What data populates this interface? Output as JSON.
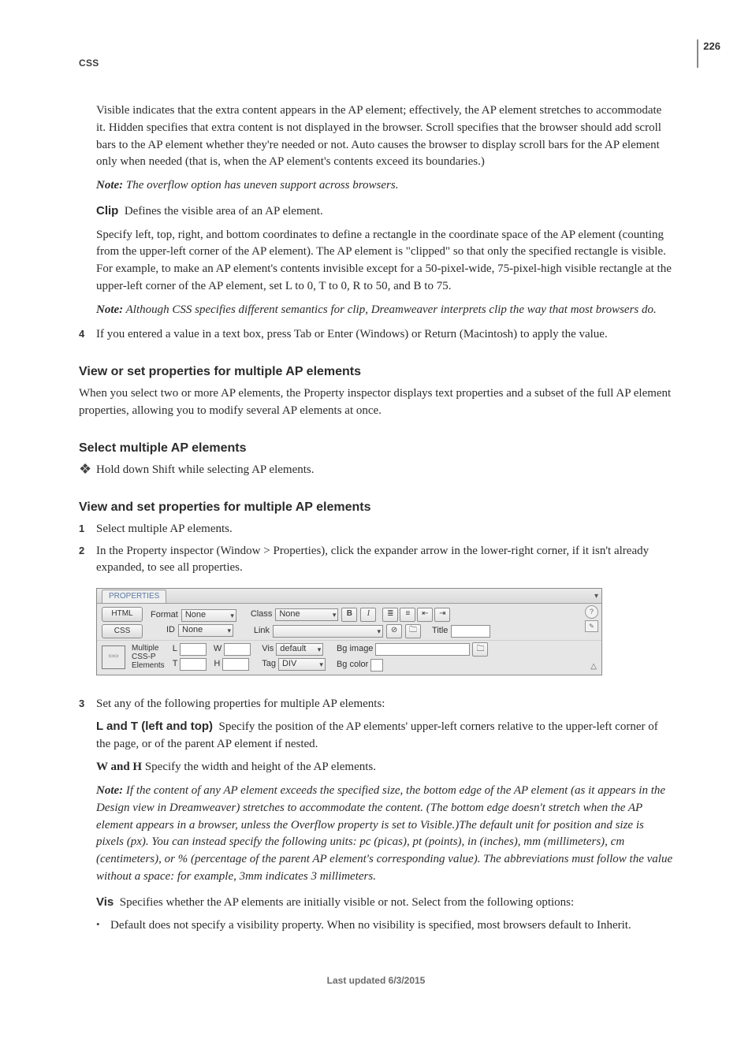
{
  "runhead": {
    "section": "CSS",
    "page_number": "226"
  },
  "intro": {
    "p1": "Visible indicates that the extra content appears in the AP element; effectively, the AP element stretches to accommodate it. Hidden specifies that extra content is not displayed in the browser. Scroll specifies that the browser should add scroll bars to the AP element whether they're needed or not. Auto causes the browser to display scroll bars for the AP element only when needed (that is, when the AP element's contents exceed its boundaries.)",
    "note1_label": "Note:",
    "note1": "The overflow option has uneven support across browsers.",
    "clip_label": "Clip",
    "clip_text": "Defines the visible area of an AP element.",
    "p2": "Specify left, top, right, and bottom coordinates to define a rectangle in the coordinate space of the AP element (counting from the upper-left corner of the AP element). The AP element is \"clipped\" so that only the specified rectangle is visible. For example, to make an AP element's contents invisible except for a 50-pixel-wide, 75-pixel-high visible rectangle at the upper-left corner of the AP element, set L to 0, T to 0, R to 50, and B to 75.",
    "note2_label": "Note:",
    "note2": "Although CSS specifies different semantics for clip, Dreamweaver interprets clip the way that most browsers do."
  },
  "step4": {
    "num": "4",
    "text": "If you entered a value in a text box, press Tab or Enter (Windows) or Return (Macintosh) to apply the value."
  },
  "h_view_set": "View or set properties for multiple AP elements",
  "view_set_p": "When you select two or more AP elements, the Property inspector displays text properties and a subset of the full AP element properties, allowing you to modify several AP elements at once.",
  "h_select": "Select multiple AP elements",
  "select_bullet": "Hold down Shift while selecting AP elements.",
  "h_view_and_set": "View and set properties for multiple AP elements",
  "step1": {
    "num": "1",
    "text": "Select multiple AP elements."
  },
  "step2": {
    "num": "2",
    "text": "In the Property inspector (Window > Properties), click the expander arrow in the lower-right corner, if it isn't already expanded, to see all properties."
  },
  "inspector": {
    "tab": "PROPERTIES",
    "html_btn": "HTML",
    "css_btn": "CSS",
    "format_label": "Format",
    "format_value": "None",
    "id_label": "ID",
    "id_value": "None",
    "class_label": "Class",
    "class_value": "None",
    "link_label": "Link",
    "bold": "B",
    "italic": "I",
    "title_label": "Title",
    "thumb_caption_1": "Multiple",
    "thumb_caption_2": "CSS-P",
    "thumb_caption_3": "Elements",
    "L": "L",
    "W": "W",
    "T": "T",
    "H": "H",
    "vis_label": "Vis",
    "vis_value": "default",
    "tag_label": "Tag",
    "tag_value": "DIV",
    "bgimage_label": "Bg image",
    "bgcolor_label": "Bg color"
  },
  "step3": {
    "num": "3",
    "text": "Set any of the following properties for multiple AP elements:",
    "lt_label": "L and T (left and top)",
    "lt_text": "Specify the position of the AP elements' upper-left corners relative to the upper-left corner of the page, or of the parent AP element if nested.",
    "wh_label": "W and H",
    "wh_text": " Specify the width and height of the AP elements.",
    "note_label": "Note:",
    "note_text": "If the content of any AP element exceeds the specified size, the bottom edge of the AP element (as it appears in the Design view in Dreamweaver) stretches to accommodate the content. (The bottom edge doesn't stretch when the AP element appears in a browser, unless the Overflow property is set to Visible.)The default unit for position and size is pixels (px). You can instead specify the following units: pc (picas), pt (points), in (inches), mm (millimeters), cm (centimeters), or % (percentage of the parent AP element's corresponding value). The abbreviations must follow the value without a space: for example, 3mm indicates 3 millimeters.",
    "vis_label": "Vis",
    "vis_text": "Specifies whether the AP elements are initially visible or not. Select from the following options:",
    "sub_bullet": "Default does not specify a visibility property. When no visibility is specified, most browsers default to Inherit."
  },
  "footer": "Last updated 6/3/2015",
  "glyphs": {
    "diamond": "❖",
    "dot": "•",
    "menu": "▾",
    "help": "?",
    "pencil": "✎",
    "folder": "🗀",
    "chain": "⊘",
    "tri": "△"
  }
}
